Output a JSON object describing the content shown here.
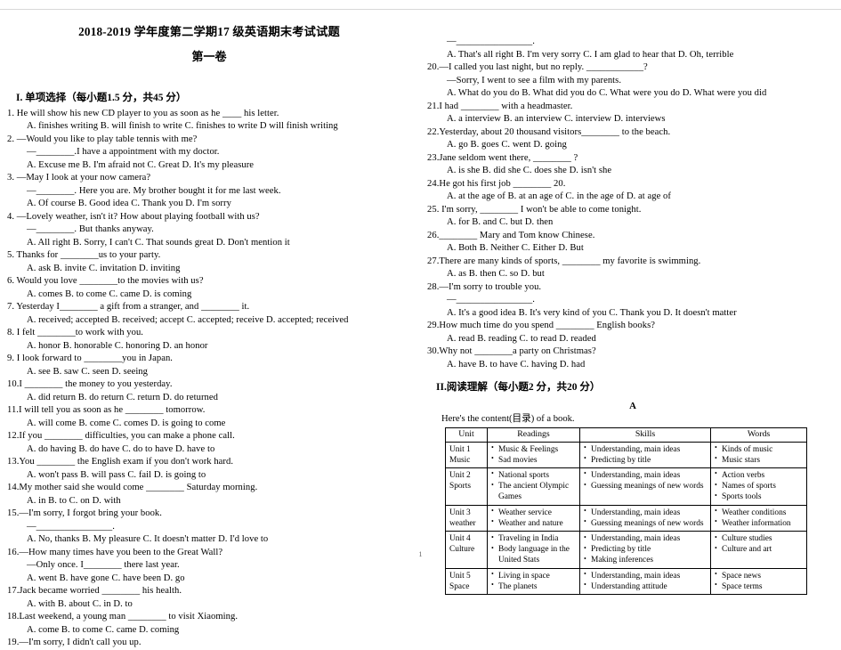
{
  "document": {
    "title": "2018-2019 学年度第二学期17 级英语期末考试试题",
    "subtitle": "第一卷",
    "page_number": "1"
  },
  "section1": {
    "heading": "I. 单项选择（每小题1.5 分，共45 分）",
    "questions": [
      {
        "stem": "1. He will show his new CD player to you as soon as he ____ his letter.",
        "options": "A.   finishes writing    B.   will finish to write    C.   finishes to write    D will finish writing"
      },
      {
        "stem": "2. —Would you like to play table tennis with me?",
        "cont": "—________.I have a appointment with my doctor.",
        "options": "A. Excuse me    B. I'm afraid not    C. Great    D. It's my pleasure"
      },
      {
        "stem": "3. —May I look at your now camera?",
        "cont": "—________. Here you are. My brother bought it for me last week.",
        "options": "A. Of course B. Good idea C. Thank you D. I'm sorry"
      },
      {
        "stem": "4. —Lovely weather, isn't it? How about playing football with us?",
        "cont": "—________. But thanks anyway.",
        "options": "A. All right B. Sorry, I can't    C. That sounds great    D. Don't mention it"
      },
      {
        "stem": "5. Thanks for ________us to your party.",
        "options": "A.   ask   B.   invite   C. invitation   D. inviting"
      },
      {
        "stem": "6. Would you love ________to the movies with us?",
        "options": "A. comes    B. to come    C. came    D. is coming"
      },
      {
        "stem": "7. Yesterday I________ a gift from a stranger, and ________ it.",
        "options": "A. received; accepted    B.   received; accept C. accepted; receive    D. accepted; received"
      },
      {
        "stem": "8. I felt ________to work with you.",
        "options": "A. honor    B. honorable    C. honoring    D. an honor"
      },
      {
        "stem": "9. I look forward to ________you in Japan.",
        "options": "A. see   B. saw   C. seen    D. seeing"
      },
      {
        "stem": "10.I ________ the money to you yesterday.",
        "options": "A. did return    B. do return    C. return    D. do returned"
      },
      {
        "stem": "11.I will tell you as soon as he ________ tomorrow.",
        "options": "A. will come    B. come    C. comes    D. is going to come"
      },
      {
        "stem": "12.If you ________ difficulties, you can make a phone call.",
        "options": "A. do having    B. do have    C. do to have    D. have to"
      },
      {
        "stem": "13.You ________ the English exam if you don't work hard.",
        "options": "A. won't pass    B. will pass    C. fail    D. is going to"
      },
      {
        "stem": "14.My mother said she would come ________ Saturday morning.",
        "options": "A. in    B. to    C. on    D. with"
      },
      {
        "stem": "15.—I'm sorry, I forgot bring your book.",
        "cont": "—________________.",
        "options": "A. No, thanks   B. My pleasure    C. It doesn't matter    D. I'd love to"
      },
      {
        "stem": "16.—How many times have you been to the Great Wall?",
        "cont": "—Only once. I________ there last year.",
        "options": "A. went    B. have gone    C. have been    D. go"
      },
      {
        "stem": "17.Jack became worried ________ his health.",
        "options": "A. with    B. about    C. in    D. to"
      },
      {
        "stem": "18.Last weekend, a young man ________ to visit Xiaoming.",
        "options": "A. come    B. to come    C. came    D. coming"
      },
      {
        "stem": "19.—I'm sorry, I didn't call you up.",
        "cont": "—________________.",
        "options": "A.  That's all right    B. I'm very sorry    C. I am glad to hear that    D. Oh, terrible"
      },
      {
        "stem": "20.—I called you last night, but no reply. ____________?",
        "cont": "—Sorry, I went to see a film with my parents.",
        "options": "A. What do you do    B. What did you do    C. What were you do    D. What were you did"
      },
      {
        "stem": "21.I had ________ with a headmaster.",
        "options": "A. a interview    B. an interview    C. interview    D. interviews"
      },
      {
        "stem": "22.Yesterday, about 20 thousand visitors________ to the beach.",
        "options": "A. go    B. goes    C. went    D. going"
      },
      {
        "stem": "23.Jane seldom went there, ________ ?",
        "options": "A. is she   B. did she    C. does she   D. isn't she"
      },
      {
        "stem": "24.He got his first job ________ 20.",
        "options": "A. at the age of    B. at an age of    C. in the age of    D. at age of"
      },
      {
        "stem": "25. I'm sorry, ________ I won't be able to come tonight.",
        "options": "A. for    B. and    C. but    D. then"
      },
      {
        "stem": "26.________ Mary and Tom know Chinese.",
        "options": "A. Both    B. Neither    C. Either    D. But"
      },
      {
        "stem": "27.There are many kinds of sports, ________ my favorite is swimming.",
        "options": "A. as    B. then    C. so    D. but"
      },
      {
        "stem": "28.—I'm sorry to trouble you.",
        "cont": "—________________.",
        "options": "A.  It's a good idea    B. It's very kind of you    C. Thank you    D. It doesn't matter"
      },
      {
        "stem": "29.How much time do you spend ________ English books?",
        "options": "A. read    B. reading    C. to read    D. readed"
      },
      {
        "stem": "30.Why not ________a party on Christmas?",
        "options": "A. have    B. to have    C. having    D. had"
      }
    ]
  },
  "section2": {
    "heading": "II.阅读理解（每小题2 分，共20 分）",
    "passage_letter": "A",
    "lead_in": "Here's the content(目录) of a book.",
    "table": {
      "headers": [
        "Unit",
        "Readings",
        "Skills",
        "Words"
      ],
      "rows": [
        {
          "unit": "Unit 1\nMusic",
          "readings": [
            "Music & Feelings",
            "Sad movies"
          ],
          "skills": [
            "Understanding, main ideas",
            "Predicting by title"
          ],
          "words": [
            "Kinds of music",
            "Music stars"
          ]
        },
        {
          "unit": "Unit 2\nSports",
          "readings": [
            "National sports",
            "The ancient Olympic Games"
          ],
          "skills": [
            "Understanding, main ideas",
            "Guessing meanings of new words"
          ],
          "words": [
            "Action verbs",
            "Names of sports",
            "Sports tools"
          ]
        },
        {
          "unit": "Unit 3\nweather",
          "readings": [
            "Weather service",
            "Weather and nature"
          ],
          "skills": [
            "Understanding, main ideas",
            "Guessing meanings of new words"
          ],
          "words": [
            "Weather conditions",
            "Weather information"
          ]
        },
        {
          "unit": "Unit 4\nCulture",
          "readings": [
            "Traveling in India",
            "Body language in the United Stats"
          ],
          "skills": [
            "Understanding, main ideas",
            "Predicting by title",
            "Making inferences"
          ],
          "words": [
            "Culture studies",
            "Culture and art"
          ]
        },
        {
          "unit": "Unit 5\nSpace",
          "readings": [
            "Living in space",
            "The planets"
          ],
          "skills": [
            "Understanding, main ideas",
            "Understanding attitude"
          ],
          "words": [
            "Space news",
            "Space terms"
          ]
        }
      ]
    }
  }
}
